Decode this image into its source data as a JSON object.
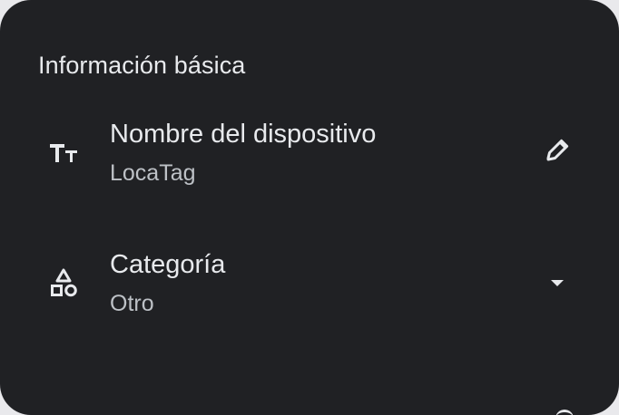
{
  "section": {
    "title": "Información básica"
  },
  "rows": [
    {
      "label": "Nombre del dispositivo",
      "value": "LocaTag",
      "icon": "text-fields-icon",
      "action_icon": "edit-pencil-icon"
    },
    {
      "label": "Categoría",
      "value": "Otro",
      "icon": "category-shapes-icon",
      "action_icon": "dropdown-arrow-icon"
    }
  ],
  "colors": {
    "background": "#202124",
    "primary_text": "#e8eaed",
    "secondary_text": "#bdc1c6"
  }
}
